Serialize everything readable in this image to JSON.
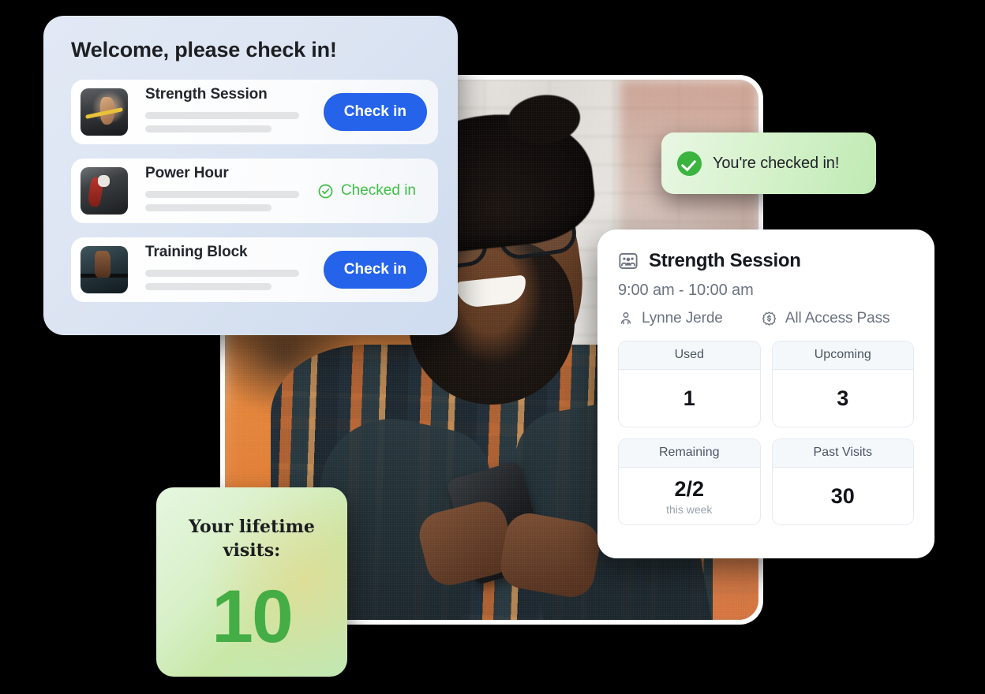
{
  "checkin_panel": {
    "title": "Welcome, please check in!",
    "classes": [
      {
        "name": "Strength Session",
        "thumbnail": "gym-suspension-training-photo",
        "action_label": "Check in",
        "status": "not_checked_in"
      },
      {
        "name": "Power Hour",
        "thumbnail": "gym-machine-workout-photo",
        "action_label": "Checked in",
        "status": "checked_in"
      },
      {
        "name": "Training Block",
        "thumbnail": "barbell-deadlift-photo",
        "action_label": "Check in",
        "status": "not_checked_in"
      }
    ]
  },
  "toast": {
    "message": "You're checked in!",
    "icon": "check-circle-filled-icon",
    "accent_color": "#3bb33f"
  },
  "session_card": {
    "icon": "group-class-icon",
    "title": "Strength Session",
    "time": "9:00 am - 10:00 am",
    "instructor": {
      "icon": "instructor-person-icon",
      "name": "Lynne Jerde"
    },
    "membership": {
      "icon": "money-badge-icon",
      "name": "All Access Pass"
    },
    "stats": [
      {
        "label": "Used",
        "value": "1",
        "sub": ""
      },
      {
        "label": "Upcoming",
        "value": "3",
        "sub": ""
      },
      {
        "label": "Remaining",
        "value": "2/2",
        "sub": "this week"
      },
      {
        "label": "Past Visits",
        "value": "30",
        "sub": ""
      }
    ]
  },
  "lifetime_card": {
    "label": "Your lifetime visits:",
    "value": "10",
    "accent_color": "#45ad45"
  },
  "photo": {
    "alt": "smiling-man-with-glasses-plaid-shirt-holding-phone"
  },
  "theme": {
    "primary_button": "#2563eb",
    "success_green": "#3fbf48",
    "panel_blue": "#dde5f3"
  }
}
